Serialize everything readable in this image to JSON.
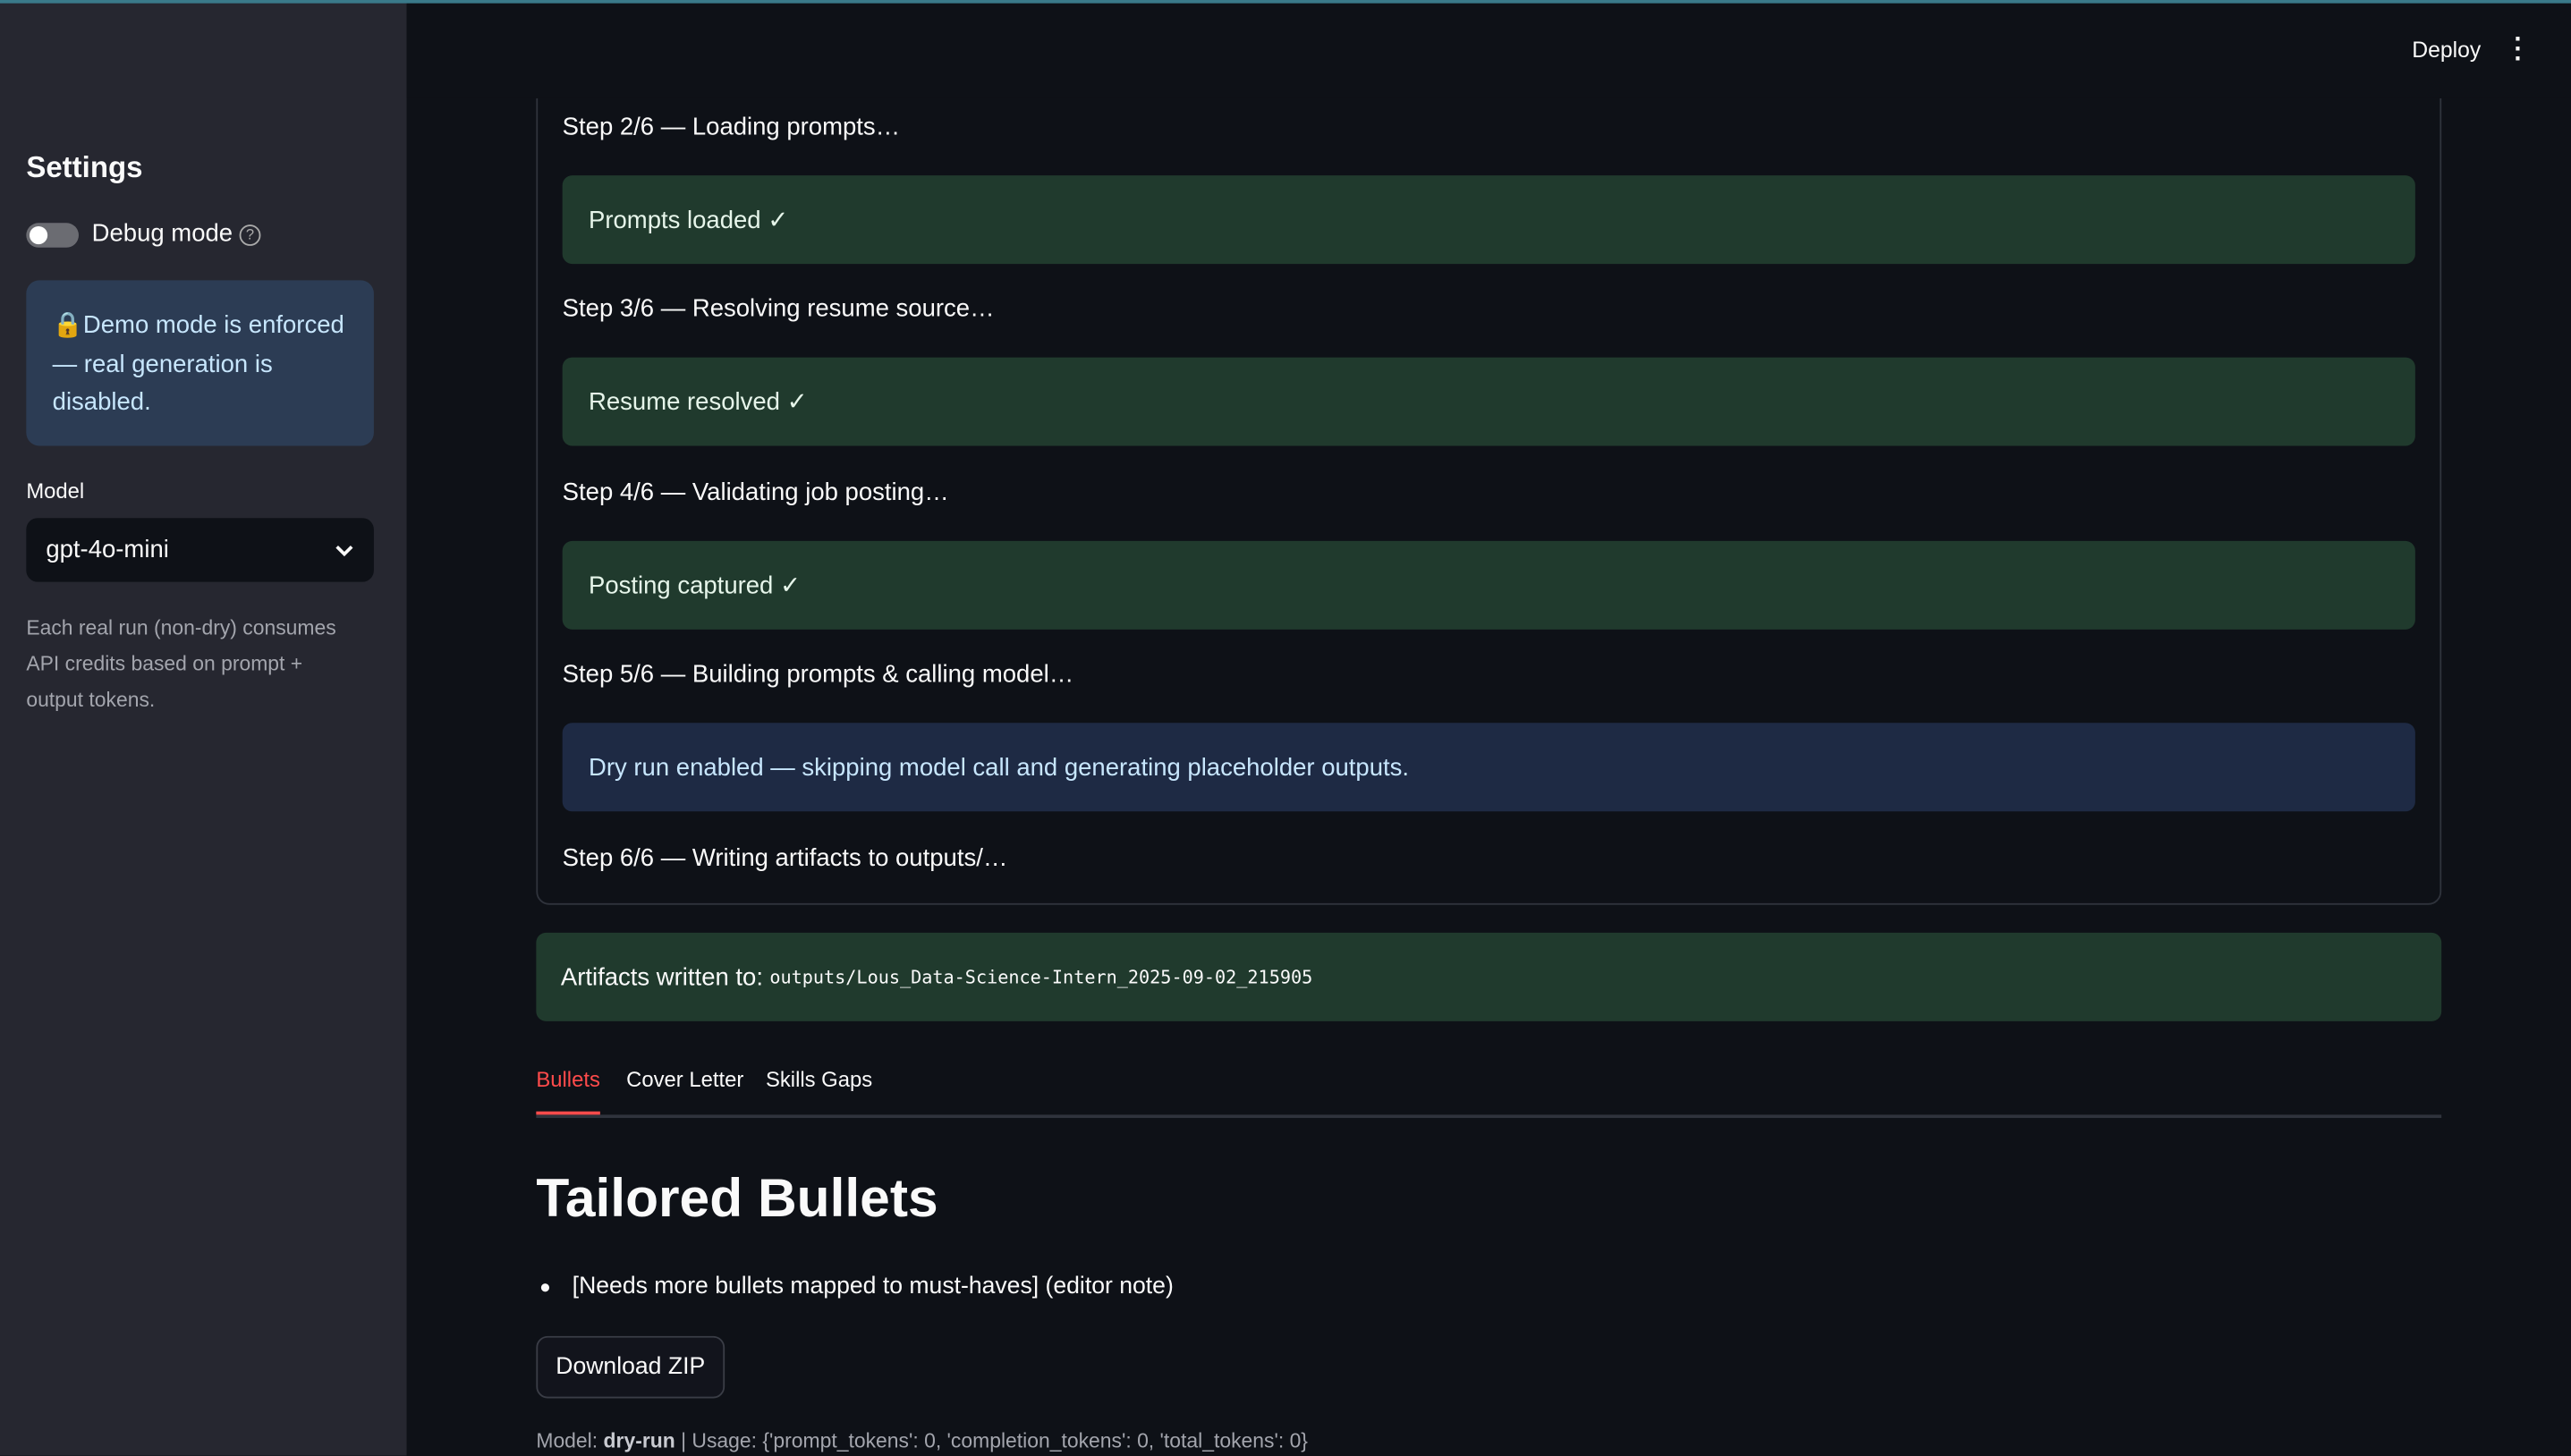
{
  "sidebar": {
    "title": "Settings",
    "debug_toggle": {
      "label": "Debug mode",
      "on": false
    },
    "demo_notice": {
      "icon": "lock-icon",
      "text": "Demo mode is enforced — real generation is disabled."
    },
    "model": {
      "label": "Model",
      "selected": "gpt-4o-mini"
    },
    "caption": "Each real run (non-dry) consumes API credits based on prompt + output tokens."
  },
  "header": {
    "deploy": "Deploy",
    "menu_icon": "kebab-menu-icon"
  },
  "status": {
    "steps": [
      {
        "label": "Step 2/6 — Loading prompts…",
        "result": "Prompts loaded ✓",
        "kind": "success"
      },
      {
        "label": "Step 3/6 — Resolving resume source…",
        "result": "Resume resolved ✓",
        "kind": "success"
      },
      {
        "label": "Step 4/6 — Validating job posting…",
        "result": "Posting captured ✓",
        "kind": "success"
      },
      {
        "label": "Step 5/6 — Building prompts & calling model…",
        "result": "Dry run enabled — skipping model call and generating placeholder outputs.",
        "kind": "info"
      },
      {
        "label": "Step 6/6 — Writing artifacts to outputs/…"
      }
    ]
  },
  "artifacts": {
    "label": "Artifacts written to:",
    "path": "outputs/Lous_Data-Science-Intern_2025-09-02_215905"
  },
  "tabs": [
    {
      "label": "Bullets",
      "active": true
    },
    {
      "label": "Cover Letter"
    },
    {
      "label": "Skills Gaps"
    }
  ],
  "content": {
    "heading": "Tailored Bullets",
    "bullets": [
      "[Needs more bullets mapped to must-haves] (editor note)"
    ],
    "download": "Download ZIP",
    "footer": {
      "model_label": "Model:",
      "model": "dry-run",
      "usage": "| Usage: {'prompt_tokens': 0, 'completion_tokens': 0, 'total_tokens': 0}"
    }
  },
  "colors": {
    "accent": "#ff4b4b",
    "success_bg": "#203a2d",
    "info_bg": "#1e2a44",
    "sidebar_bg": "#262730",
    "main_bg": "#0e1117"
  }
}
